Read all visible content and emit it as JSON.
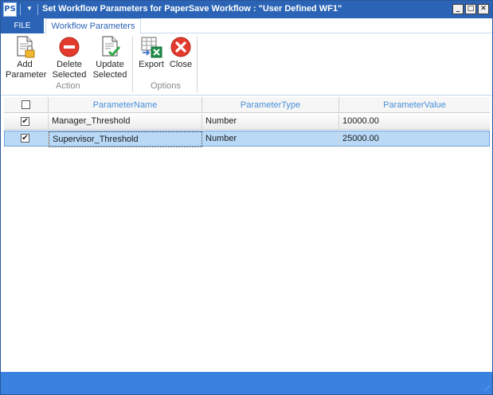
{
  "window": {
    "title": "Set Workflow Parameters for PaperSave Workflow : \"User Defined WF1\"",
    "app_icon_label": "PS",
    "controls": {
      "minimize": "_",
      "maximize": "□",
      "close": "✕"
    }
  },
  "tabs": {
    "file": "FILE",
    "active": "Workflow Parameters"
  },
  "ribbon": {
    "groups": [
      {
        "label": "Action"
      },
      {
        "label": "Options"
      }
    ],
    "buttons": {
      "add": {
        "line1": "Add",
        "line2": "Parameter",
        "icon": "add-document-lock-icon"
      },
      "delete": {
        "line1": "Delete",
        "line2": "Selected",
        "icon": "delete-minus-icon"
      },
      "update": {
        "line1": "Update",
        "line2": "Selected",
        "icon": "update-document-check-icon"
      },
      "export": {
        "line1": "Export",
        "icon": "export-excel-icon"
      },
      "close": {
        "line1": "Close",
        "icon": "close-x-icon"
      }
    }
  },
  "grid": {
    "columns": [
      "ParameterName",
      "ParameterType",
      "ParameterValue"
    ],
    "select_all_checked": false,
    "rows": [
      {
        "checked": true,
        "name": "Manager_Threshold",
        "type": "Number",
        "value": "10000.00"
      },
      {
        "checked": true,
        "name": "Supervisor_Threshold",
        "type": "Number",
        "value": "25000.00"
      }
    ]
  },
  "colors": {
    "titlebar": "#2b64b6",
    "accent": "#3b82e0",
    "header_text": "#4a8fd8",
    "selected_row": "#b9d9f7"
  }
}
